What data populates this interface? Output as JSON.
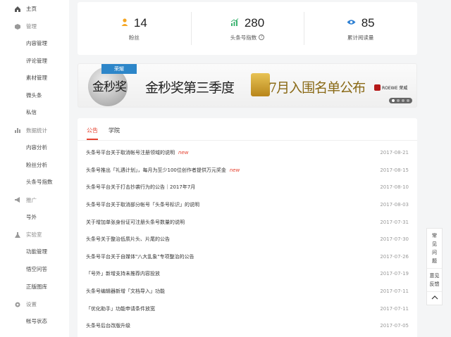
{
  "sidebar": {
    "home": "主页",
    "manage": {
      "title": "管理",
      "items": [
        "内容管理",
        "评论管理",
        "素材管理",
        "微头条",
        "私信"
      ]
    },
    "data": {
      "title": "数据统计",
      "items": [
        "内容分析",
        "粉丝分析",
        "头条号指数"
      ]
    },
    "promo": {
      "title": "推广",
      "items": [
        "号外"
      ]
    },
    "lab": {
      "title": "实验室",
      "items": [
        "功能管理",
        "悟空问答",
        "正版图库"
      ]
    },
    "settings": {
      "title": "设置",
      "items": [
        "帐号状态"
      ]
    }
  },
  "stats": [
    {
      "value": "14",
      "label": "粉丝",
      "icon": "person-icon",
      "color": "#f5a623"
    },
    {
      "value": "280",
      "label": "头条号指数",
      "icon": "trend-icon",
      "color": "#3cb371",
      "help": "?"
    },
    {
      "value": "85",
      "label": "累计阅读量",
      "icon": "eye-icon",
      "color": "#2d7fd3"
    }
  ],
  "banner": {
    "ribbon": "荣耀",
    "medal": "金秒奖",
    "title_a": "金秒奖第三季度",
    "title_b": "7月入围名单公布",
    "sponsor": "ROEWE 荣威"
  },
  "tabs": [
    "公告",
    "学院"
  ],
  "announcements": [
    {
      "title": "头条号平台关于取消帐号注册领域的说明",
      "badge": "new",
      "date": "2017-08-21"
    },
    {
      "title": "头条号推出「礼遇计划」，每月为至少100位创作者提供万元奖金",
      "badge": "new",
      "date": "2017-08-15"
    },
    {
      "title": "头条号平台关于打击抄袭行为的公告｜2017年7月",
      "badge": "",
      "date": "2017-08-10"
    },
    {
      "title": "头条号平台关于取消部分帐号「头条号标识」的说明",
      "badge": "",
      "date": "2017-08-03"
    },
    {
      "title": "关于增加单张身份证可注册头条号数量的说明",
      "badge": "",
      "date": "2017-07-31"
    },
    {
      "title": "头条号关于整治低质片头、片尾的公告",
      "badge": "",
      "date": "2017-07-30"
    },
    {
      "title": "头条号平台关于自媒体\"八大乱象\"专项整治的公告",
      "badge": "",
      "date": "2017-07-26"
    },
    {
      "title": "「号外」新增支持未推荐内容投放",
      "badge": "",
      "date": "2017-07-19"
    },
    {
      "title": "头条号编辑器新增「文档导入」功能",
      "badge": "",
      "date": "2017-07-11"
    },
    {
      "title": "「优化助手」功能申请条件放宽",
      "badge": "",
      "date": "2017-07-11"
    },
    {
      "title": "头条号后台改版升级",
      "badge": "",
      "date": "2017-07-05"
    }
  ],
  "floating": {
    "faq": "常见问题",
    "feedback": "意见反馈",
    "top": "^"
  }
}
